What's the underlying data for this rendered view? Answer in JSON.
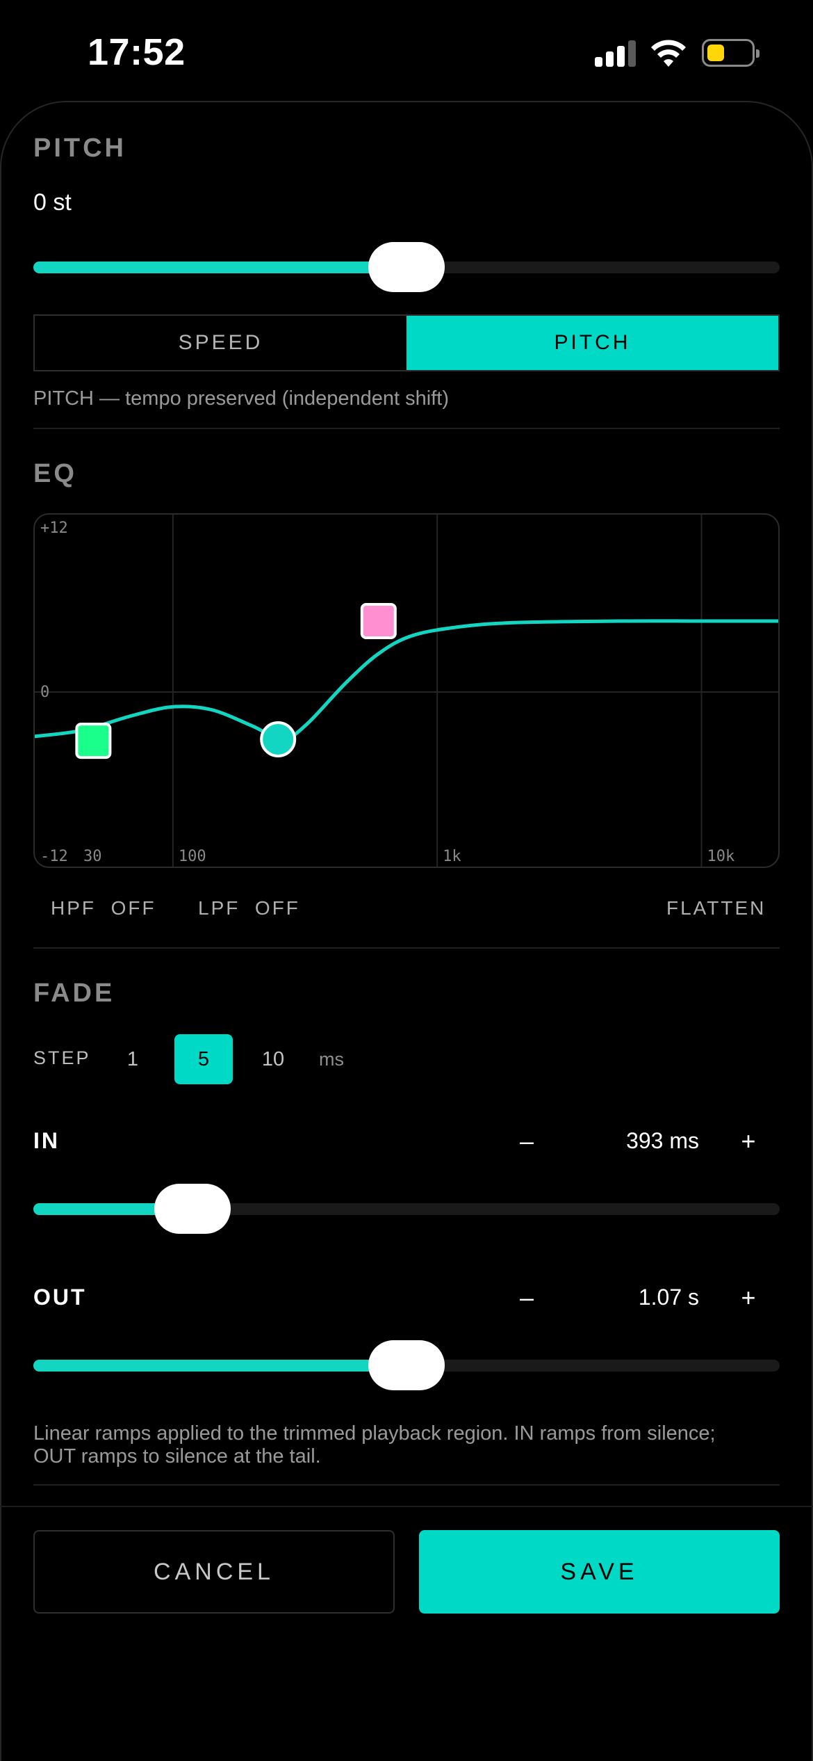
{
  "status_bar": {
    "time": "17:52",
    "battery_level": 0.4,
    "signal_bars": 3
  },
  "pitch": {
    "title": "PITCH",
    "value_text": "0 st",
    "slider_value": 0.5,
    "mode_options": [
      "SPEED",
      "PITCH"
    ],
    "selected_mode": "PITCH",
    "mode_caption": "PITCH — tempo preserved (independent shift)"
  },
  "eq": {
    "title": "EQ",
    "y_labels": {
      "top": "+12",
      "mid": "0",
      "bottom": "-12"
    },
    "x_labels": [
      "30",
      "100",
      "1k",
      "10k"
    ],
    "y_range": [
      -12,
      12
    ],
    "x_range_hz": [
      30,
      20000
    ],
    "curve_color": "#12d6c2",
    "nodes": [
      {
        "name": "low",
        "freq_hz": 50,
        "gain_db": -3.3,
        "shape": "square",
        "color": "#1aff8c"
      },
      {
        "name": "mid",
        "freq_hz": 250,
        "gain_db": -3.2,
        "shape": "circle",
        "color": "#12d6c2"
      },
      {
        "name": "high",
        "freq_hz": 600,
        "gain_db": 4.8,
        "shape": "square",
        "color": "#ff8fd0"
      }
    ],
    "curve_points": [
      [
        30,
        -3.0
      ],
      [
        45,
        -2.6
      ],
      [
        70,
        -1.6
      ],
      [
        100,
        -1.0
      ],
      [
        140,
        -1.2
      ],
      [
        200,
        -2.3
      ],
      [
        260,
        -3.2
      ],
      [
        320,
        -2.2
      ],
      [
        450,
        0.6
      ],
      [
        600,
        2.6
      ],
      [
        800,
        3.8
      ],
      [
        1200,
        4.4
      ],
      [
        2000,
        4.7
      ],
      [
        5000,
        4.8
      ],
      [
        10000,
        4.8
      ],
      [
        20000,
        4.8
      ]
    ],
    "hpf_label": "HPF",
    "hpf_value": "OFF",
    "lpf_label": "LPF",
    "lpf_value": "OFF",
    "flatten_label": "FLATTEN"
  },
  "fade": {
    "title": "FADE",
    "step_label": "STEP",
    "step_options": [
      "1",
      "5",
      "10"
    ],
    "step_selected": "5",
    "step_unit": "ms",
    "in_label": "IN",
    "in_value": "393 ms",
    "in_slider_value": 0.18,
    "out_label": "OUT",
    "out_value": "1.07 s",
    "out_slider_value": 0.5,
    "minus": "–",
    "plus": "+",
    "caption_line1": "Linear ramps applied to the trimmed playback region. IN ramps from silence;",
    "caption_line2": "OUT ramps to silence at the tail."
  },
  "actions": {
    "cancel": "CANCEL",
    "save": "SAVE"
  }
}
